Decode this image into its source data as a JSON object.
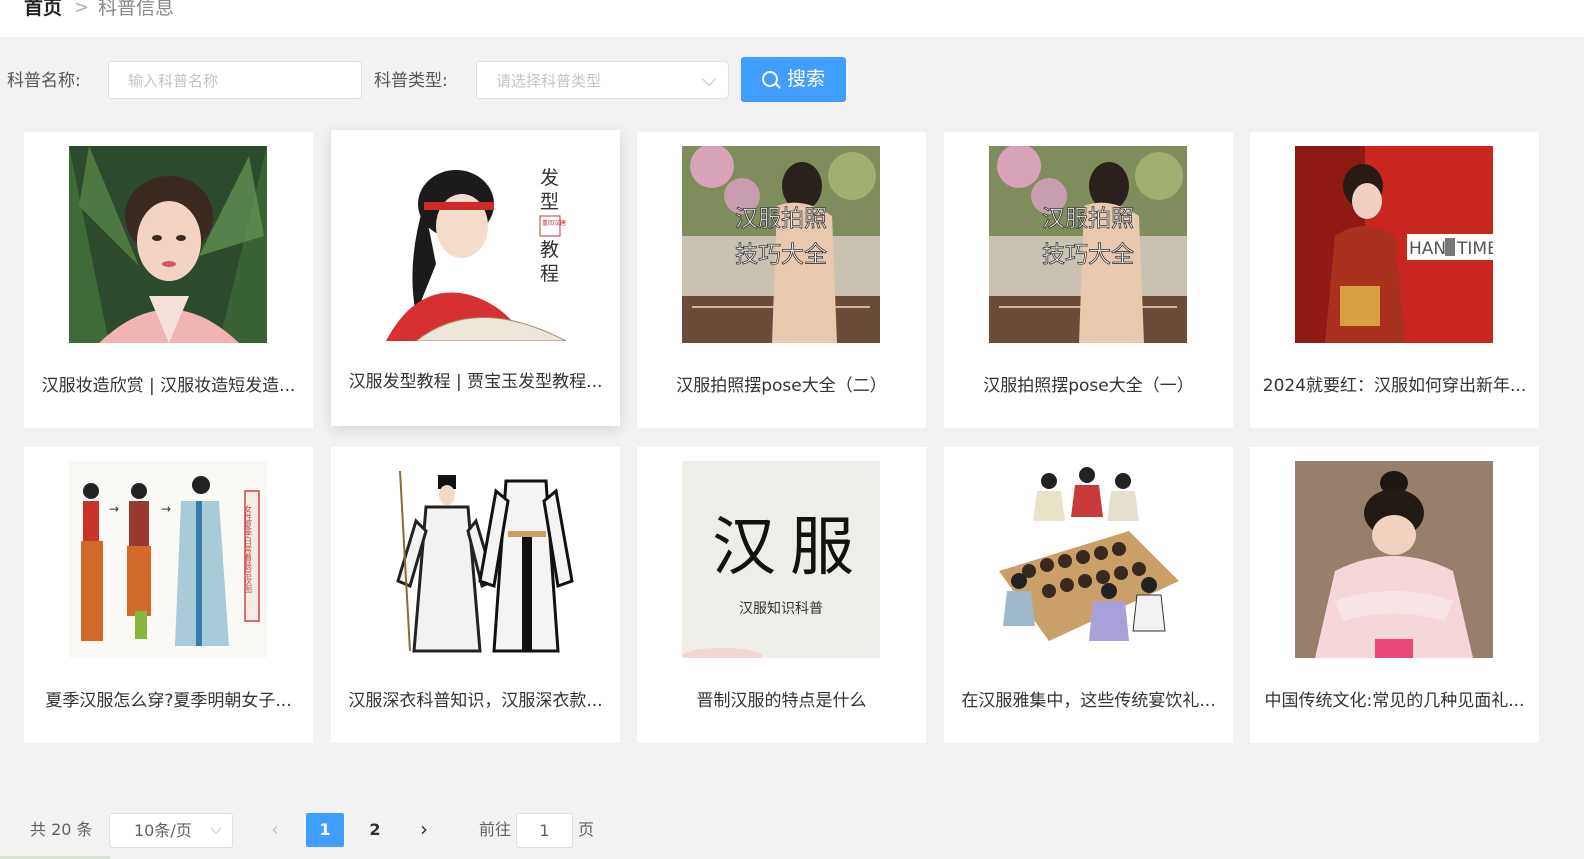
{
  "breadcrumb": {
    "home": "首页",
    "separator": ">",
    "current": "科普信息"
  },
  "filters": {
    "name_label": "科普名称:",
    "name_placeholder": "输入科普名称",
    "type_label": "科普类型:",
    "type_placeholder": "请选择科普类型",
    "search_label": "搜索"
  },
  "cards": [
    {
      "title": "汉服妆造欣赏 | 汉服妆造短发造..."
    },
    {
      "title": "汉服发型教程 | 贾宝玉发型教程...",
      "image_text": [
        "发",
        "型",
        "教",
        "程"
      ],
      "stamp": "重回汉唐"
    },
    {
      "title": "汉服拍照摆pose大全（二）",
      "image_text": [
        "汉服拍照",
        "技巧大全"
      ]
    },
    {
      "title": "汉服拍照摆pose大全（一）",
      "image_text": [
        "汉服拍照",
        "技巧大全"
      ]
    },
    {
      "title": "2024就要红：汉服如何穿出新年...",
      "image_text": [
        "HAN",
        "TIME"
      ]
    },
    {
      "title": "夏季汉服怎么穿?夏季明朝女子...",
      "image_text": [
        "女性夏季日常着装层次图"
      ]
    },
    {
      "title": "汉服深衣科普知识，汉服深衣款..."
    },
    {
      "title": "晋制汉服的特点是什么",
      "image_text": [
        "汉",
        "服",
        "汉服知识科普"
      ]
    },
    {
      "title": "在汉服雅集中，这些传统宴饮礼..."
    },
    {
      "title": "中国传统文化:常见的几种见面礼..."
    }
  ],
  "pagination": {
    "total": "共 20 条",
    "page_size": "10条/页",
    "prev": "‹",
    "pages": [
      "1",
      "2"
    ],
    "active_page": "1",
    "next": "›",
    "goto_label": "前往",
    "goto_value": "1",
    "page_suffix": "页"
  },
  "colors": {
    "primary": "#409eff",
    "background": "#f2f2f2",
    "card": "#ffffff"
  }
}
